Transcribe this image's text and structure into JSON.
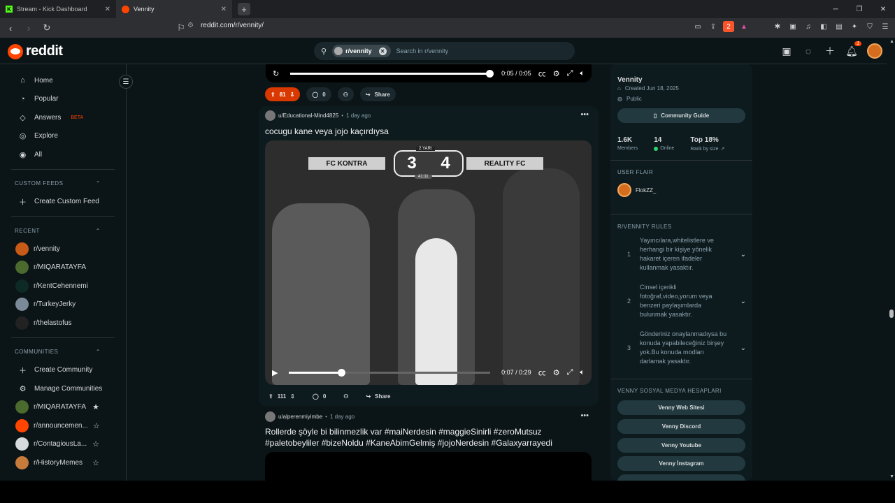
{
  "browser": {
    "tabs": [
      {
        "title": "Stream - Kick Dashboard",
        "active": false
      },
      {
        "title": "Vennity",
        "active": true
      }
    ],
    "url": "reddit.com/r/vennity/",
    "shields_count": "2"
  },
  "header": {
    "logo_text": "reddit",
    "search_chip": "r/vennity",
    "search_placeholder": "Search in r/vennity",
    "notif_count": "1"
  },
  "leftnav": {
    "main": [
      {
        "label": "Home",
        "icon": "home-icon"
      },
      {
        "label": "Popular",
        "icon": "popular-icon"
      },
      {
        "label": "Answers",
        "icon": "answers-icon",
        "badge": "BETA"
      },
      {
        "label": "Explore",
        "icon": "explore-icon"
      },
      {
        "label": "All",
        "icon": "all-icon"
      }
    ],
    "custom_feeds_title": "CUSTOM FEEDS",
    "create_custom_feed": "Create Custom Feed",
    "recent_title": "RECENT",
    "recent": [
      "r/vennity",
      "r/MIQARATAYFA",
      "r/KentCehennemi",
      "r/TurkeyJerky",
      "r/thelastofus"
    ],
    "communities_title": "COMMUNITIES",
    "create_community": "Create Community",
    "manage_communities": "Manage Communities",
    "communities": [
      "r/MIQARATAYFA",
      "r/announcemen...",
      "r/ContagiousLa...",
      "r/HistoryMemes"
    ]
  },
  "feed": {
    "top_player": {
      "time": "0:05 / 0:05",
      "progress": 1.0
    },
    "top_actions": {
      "votes": "81",
      "comments": "0",
      "share": "Share"
    },
    "post1": {
      "author": "u/Educational-Mind4825",
      "time": "1 day ago",
      "title": "cocugu kane veya jojo kaçırdıysa",
      "scoreboard": {
        "team_left": "FC KONTRA",
        "team_right": "REALITY FC",
        "score_left": "3",
        "score_right": "4",
        "half": "2.YARI",
        "clock": "41:11"
      },
      "video_time": "0:07 / 0:29",
      "progress": 0.24,
      "votes": "111",
      "comments": "0",
      "share": "Share"
    },
    "post2": {
      "author": "u/alperenmiyimbe",
      "time": "1 day ago",
      "title": "Rollerde şöyle bi bilinmezlik var #maiNerdesin #maggieSinirli #zeroMutsuz #paletobeyliler #bizeNoldu #KaneAbimGelmiş #jojoNerdesin #Galaxyarrayedi"
    }
  },
  "sidebar": {
    "name": "Vennity",
    "created": "Created Jun 18, 2025",
    "visibility": "Public",
    "guide_button": "Community Guide",
    "stats": [
      {
        "value": "1.6K",
        "label": "Members"
      },
      {
        "value": "14",
        "label": "Online"
      },
      {
        "value": "Top 18%",
        "label": "Rank by size"
      }
    ],
    "user_flair_title": "USER FLAIR",
    "flair_name": "FlokZZ_",
    "rules_title": "R/VENNITY RULES",
    "rules": [
      {
        "n": "1",
        "text": "Yayıncılara,whitelistlere ve herhangi bir kişiye yönelik hakaret içeren ifadeler kullanmak yasaktır."
      },
      {
        "n": "2",
        "text": "Cinsel içerikli fotoğraf,video,yorum veya benzeri paylaşımlarda bulunmak yasaktır."
      },
      {
        "n": "3",
        "text": "Gönderiniz onaylanmadıysa bu konuda yapabileceğiniz birşey yok.Bu konuda modları darlamak yasaktır."
      }
    ],
    "social_title": "VENNY SOSYAL MEDYA HESAPLARI",
    "social_links": [
      "Venny Web Sitesi",
      "Venny Discord",
      "Venny Youtube",
      "Venny İnstagram"
    ]
  }
}
